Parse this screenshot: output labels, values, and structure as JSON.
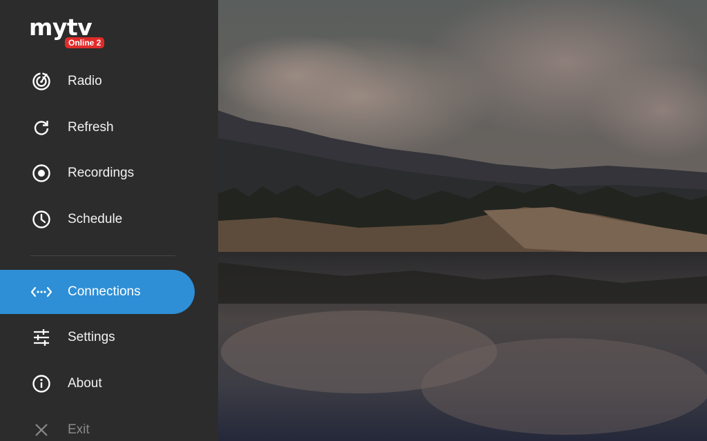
{
  "app": {
    "logo_text": "mytv",
    "logo_badge": "Online 2"
  },
  "menu": {
    "items": [
      {
        "label": "Radio",
        "icon": "radio-icon"
      },
      {
        "label": "Refresh",
        "icon": "refresh-icon"
      },
      {
        "label": "Recordings",
        "icon": "record-icon"
      },
      {
        "label": "Schedule",
        "icon": "clock-icon"
      },
      {
        "label": "Connections",
        "icon": "connections-icon",
        "active": true
      },
      {
        "label": "Settings",
        "icon": "sliders-icon"
      },
      {
        "label": "About",
        "icon": "info-icon"
      },
      {
        "label": "Exit",
        "icon": "close-icon"
      }
    ]
  },
  "colors": {
    "sidebar": "#2c2c2c",
    "accent": "#2e8fd6",
    "badge": "#e02b2b"
  }
}
